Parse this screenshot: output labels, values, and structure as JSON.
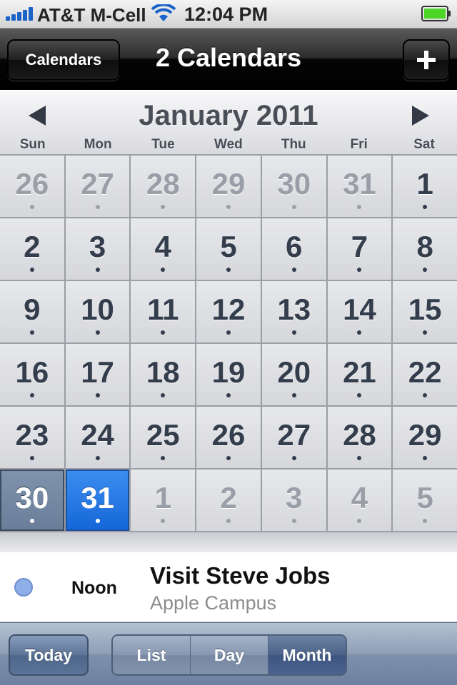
{
  "status_bar": {
    "carrier": "AT&T M-Cell",
    "time": "12:04 PM",
    "icons": [
      "signal-icon",
      "wifi-icon",
      "battery-icon"
    ]
  },
  "nav": {
    "calendars_button": "Calendars",
    "title": "2 Calendars",
    "add_button": "+"
  },
  "month": {
    "title": "January 2011",
    "weekdays": [
      "Sun",
      "Mon",
      "Tue",
      "Wed",
      "Thu",
      "Fri",
      "Sat"
    ]
  },
  "grid": {
    "days": [
      {
        "d": "26",
        "other": true
      },
      {
        "d": "27",
        "other": true
      },
      {
        "d": "28",
        "other": true
      },
      {
        "d": "29",
        "other": true
      },
      {
        "d": "30",
        "other": true
      },
      {
        "d": "31",
        "other": true
      },
      {
        "d": "1"
      },
      {
        "d": "2"
      },
      {
        "d": "3"
      },
      {
        "d": "4"
      },
      {
        "d": "5"
      },
      {
        "d": "6"
      },
      {
        "d": "7"
      },
      {
        "d": "8"
      },
      {
        "d": "9"
      },
      {
        "d": "10"
      },
      {
        "d": "11"
      },
      {
        "d": "12"
      },
      {
        "d": "13"
      },
      {
        "d": "14"
      },
      {
        "d": "15"
      },
      {
        "d": "16"
      },
      {
        "d": "17"
      },
      {
        "d": "18"
      },
      {
        "d": "19"
      },
      {
        "d": "20"
      },
      {
        "d": "21"
      },
      {
        "d": "22"
      },
      {
        "d": "23"
      },
      {
        "d": "24"
      },
      {
        "d": "25"
      },
      {
        "d": "26"
      },
      {
        "d": "27"
      },
      {
        "d": "28"
      },
      {
        "d": "29"
      },
      {
        "d": "30",
        "state": "today"
      },
      {
        "d": "31",
        "state": "selected"
      },
      {
        "d": "1",
        "other": true
      },
      {
        "d": "2",
        "other": true
      },
      {
        "d": "3",
        "other": true
      },
      {
        "d": "4",
        "other": true
      },
      {
        "d": "5",
        "other": true
      }
    ]
  },
  "event": {
    "time": "Noon",
    "title": "Visit Steve Jobs",
    "location": "Apple Campus",
    "calendar_color": "#8eaee8"
  },
  "toolbar": {
    "today": "Today",
    "views": [
      "List",
      "Day",
      "Month"
    ],
    "active_view": "Month"
  }
}
